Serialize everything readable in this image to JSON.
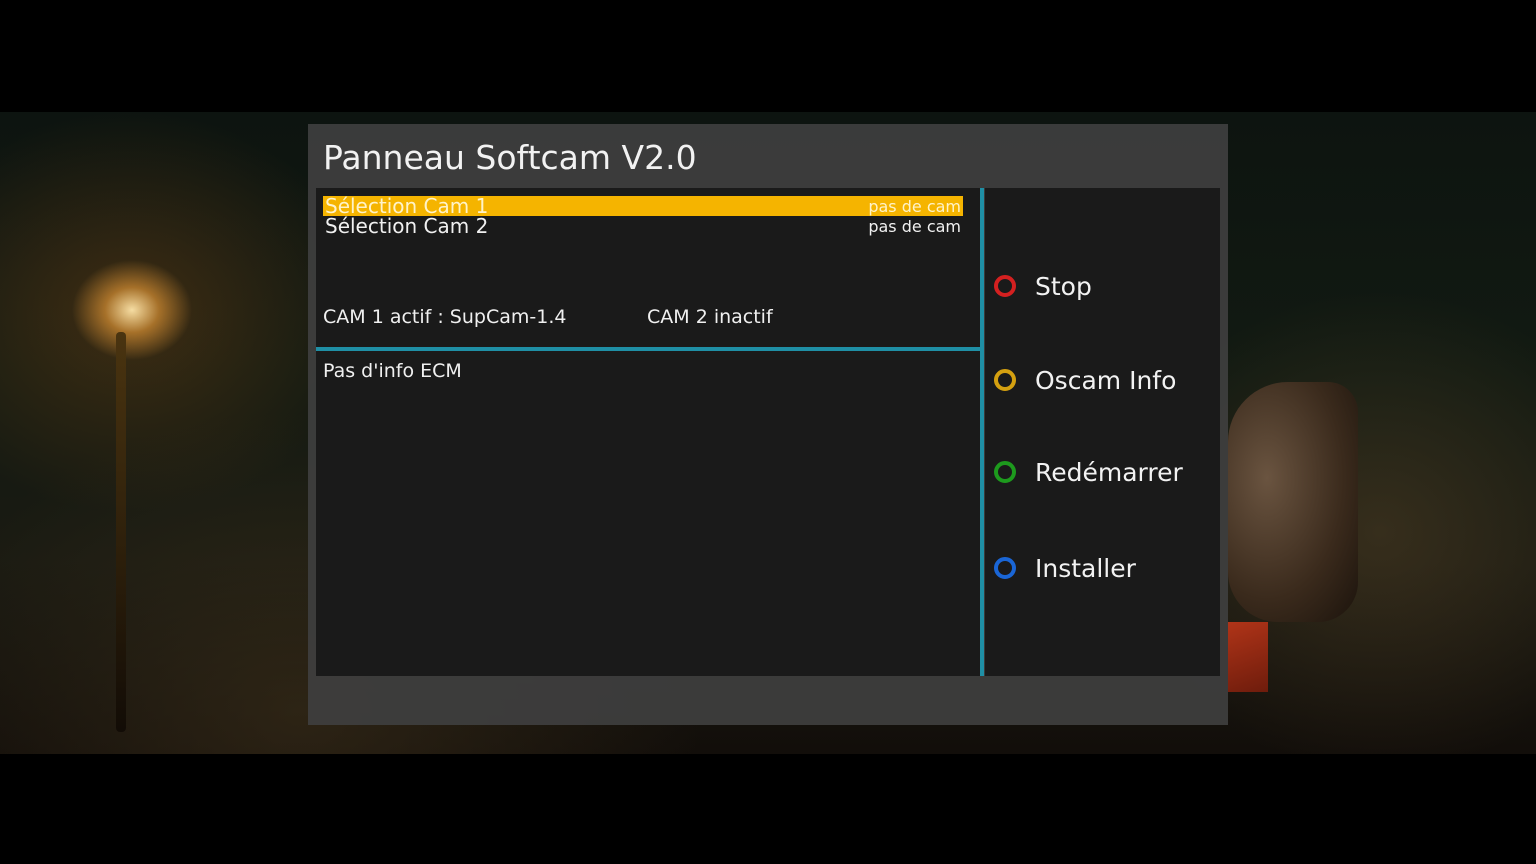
{
  "title": "Panneau Softcam V2.0",
  "cam_list": [
    {
      "label": "Sélection Cam 1",
      "value": "pas de cam",
      "selected": true
    },
    {
      "label": "Sélection Cam 2",
      "value": "pas de cam",
      "selected": false
    }
  ],
  "status": {
    "cam1": "CAM 1 actif : SupCam-1.4",
    "cam2": "CAM 2 inactif"
  },
  "ecm_info": "Pas d'info ECM",
  "buttons": [
    {
      "label": "Stop",
      "color": "#d42020",
      "icon": "red-circle-icon"
    },
    {
      "label": "Oscam Info",
      "color": "#d4a010",
      "icon": "yellow-circle-icon"
    },
    {
      "label": "Redémarrer",
      "color": "#1d9a1d",
      "icon": "green-circle-icon"
    },
    {
      "label": "Installer",
      "color": "#1a66d6",
      "icon": "blue-circle-icon"
    }
  ],
  "colors": {
    "selection": "#f5b400",
    "divider": "#1f8fa5"
  }
}
